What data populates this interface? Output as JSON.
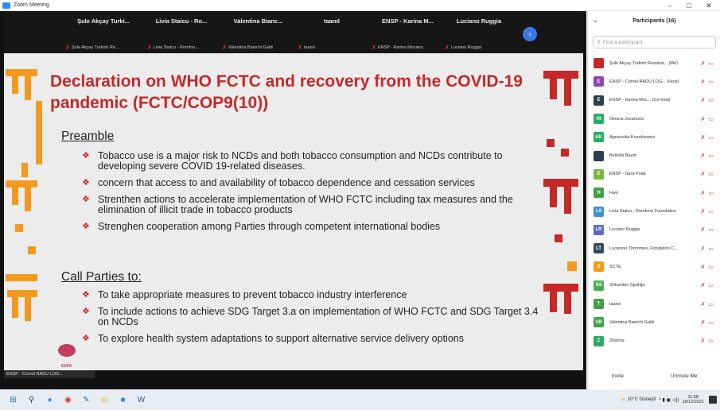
{
  "window": {
    "title": "Zoom Meeting",
    "min": "–",
    "max": "□",
    "close": "✕"
  },
  "video_strip": {
    "tiles": [
      {
        "name": "Şule Akçay Turki...",
        "label": "Şule Akçay Turkish Re..."
      },
      {
        "name": "Livia Staicu - Ro...",
        "label": "Livia Staicu - Romfon..."
      },
      {
        "name": "Valentina Bianc...",
        "label": "Valentina Bianchi Galdi"
      },
      {
        "name": "taand",
        "label": "taand"
      },
      {
        "name": "ENSP - Karina M...",
        "label": "ENSP - Karina Mocanu"
      },
      {
        "name": "Luciano Ruggia",
        "label": "Luciano Ruggia"
      }
    ],
    "next_icon": "chevron-right-icon"
  },
  "slide": {
    "title": "Declaration on WHO FCTC and recovery from the COVID-19 pandemic (FCTC/COP9(10))",
    "preamble": {
      "heading": "Preamble",
      "bullets": [
        "Tobacco use is a major risk to NCDs and both tobacco consumption and NCDs contribute to developing severe COVID 19-related diseases.",
        "concern that access to and availability of tobacco dependence and cessation services",
        "Strenthen actions to accelerate implementation of WHO FCTC including tax measures and the elimination of illicit trade in tobacco products",
        "Strenghen cooperation among Parties through competent international bodies"
      ]
    },
    "call": {
      "heading": "Call Parties to:",
      "bullets": [
        "To take appropriate measures to prevent tobacco industry interference",
        "To include actions to achieve SDG Target 3.a on implementation of WHO FCTC and SDG Target 3.4 on NCDs",
        "To explore health system adaptations to support alternative service delivery options"
      ]
    },
    "logo_small": "ESPA",
    "colors": {
      "title": "#c62828",
      "deco_red": "#c62828",
      "deco_orange": "#f39a1e"
    }
  },
  "speaker_label": "ENSP - Cornel RADU LOG...",
  "participants": {
    "title": "Participants (16)",
    "search_placeholder": "Find a participant",
    "items": [
      {
        "initials": "",
        "color": "#c62828",
        "name": "Şule Akçay Turkish Respirat...  (Me)"
      },
      {
        "initials": "E",
        "color": "#8e44ad",
        "name": "ENSP - Cornel RADU LOG...  (Host)"
      },
      {
        "initials": "E",
        "color": "#2c3e50",
        "name": "ENSP - Karina Moc...  (Co-host)"
      },
      {
        "initials": "OI",
        "color": "#27ae60",
        "name": "Olivera Jovanovic"
      },
      {
        "initials": "AK",
        "color": "#27ae60",
        "name": "Agnieszka Kozakiewicz"
      },
      {
        "initials": "",
        "color": "#2c3e50",
        "name": "Belinda Baum"
      },
      {
        "initials": "E",
        "color": "#7cb342",
        "name": "ENSP - Sara Polat"
      },
      {
        "initials": "H",
        "color": "#43a047",
        "name": "Havi"
      },
      {
        "initials": "LS",
        "color": "#3f8fd2",
        "name": "Livia Staicu - Romfono Foundation"
      },
      {
        "initials": "LR",
        "color": "#5c6bc0",
        "name": "Luciano Ruggia"
      },
      {
        "initials": "LT",
        "color": "#34495e",
        "name": "Lucienne Thommes, Fondation C..."
      },
      {
        "initials": "S",
        "color": "#f39c12",
        "name": "SCTE"
      },
      {
        "initials": "SS",
        "color": "#4caf50",
        "name": "Shkumbin Spahija"
      },
      {
        "initials": "T",
        "color": "#43a047",
        "name": "taand"
      },
      {
        "initials": "VB",
        "color": "#43a047",
        "name": "Valentina Bianchi Galdi"
      },
      {
        "initials": "Z",
        "color": "#27ae60",
        "name": "Zhanna"
      }
    ],
    "invite": "Invite",
    "mute_all": "Unmute Me"
  },
  "taskbar": {
    "weather": "10°C Güneşli",
    "time": "11:58",
    "date": "18/12/2021"
  }
}
